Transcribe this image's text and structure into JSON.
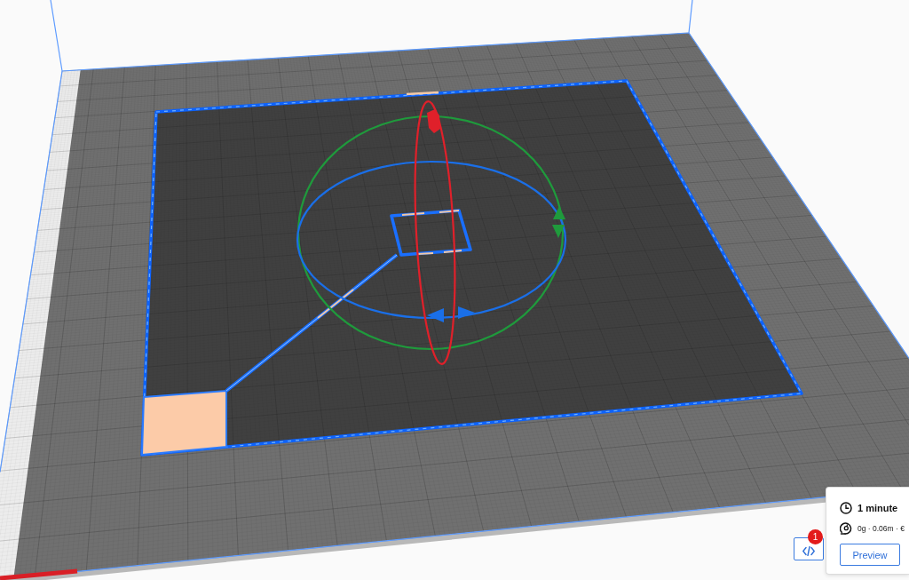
{
  "print_panel": {
    "duration": "1 minute",
    "material_estimate": "0g · 0.06m · €",
    "preview_button": "Preview"
  },
  "toolbar_button": {
    "badge": "1"
  }
}
